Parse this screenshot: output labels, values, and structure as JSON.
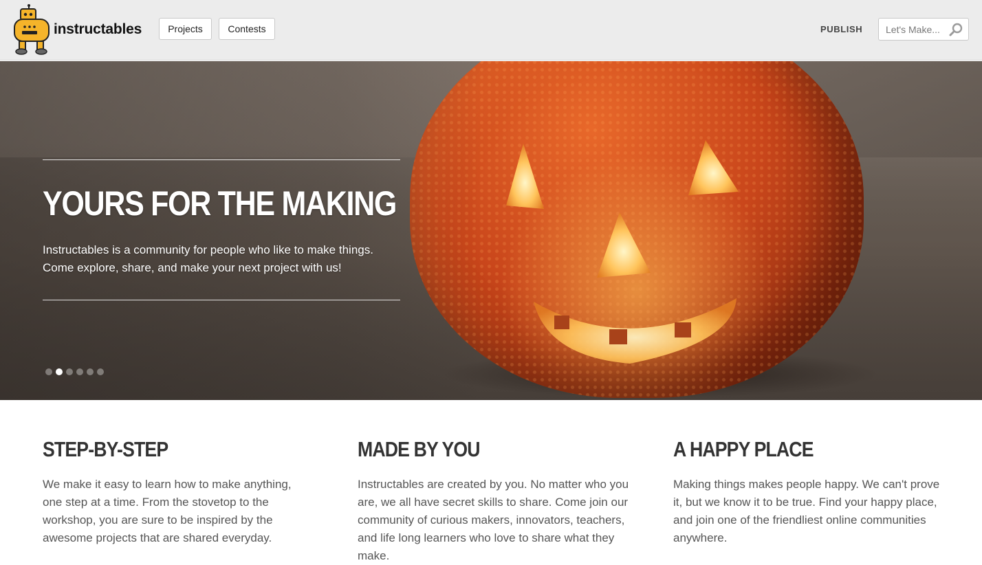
{
  "header": {
    "logo_text": "instructables",
    "nav": {
      "projects": "Projects",
      "contests": "Contests"
    },
    "publish": "PUBLISH",
    "search": {
      "placeholder": "Let's Make...",
      "value": ""
    }
  },
  "hero": {
    "title": "YOURS FOR THE MAKING",
    "description": "Instructables is a community for people who like to make things. Come explore, share, and make your next project with us!",
    "slides_total": 6,
    "active_slide": 2
  },
  "features": [
    {
      "title": "STEP-BY-STEP",
      "text": "We make it easy to learn how to make anything, one step at a time. From the stovetop to the workshop, you are sure to be inspired by the awesome projects that are shared everyday."
    },
    {
      "title": "MADE BY YOU",
      "text": "Instructables are created by you. No matter who you are, we all have secret skills to share. Come join our community of curious makers, innovators, teachers, and life long learners who love to share what they make."
    },
    {
      "title": "A HAPPY PLACE",
      "text": "Making things makes people happy. We can't prove it, but we know it to be true. Find your happy place, and join one of the friendliest online communities anywhere."
    }
  ]
}
